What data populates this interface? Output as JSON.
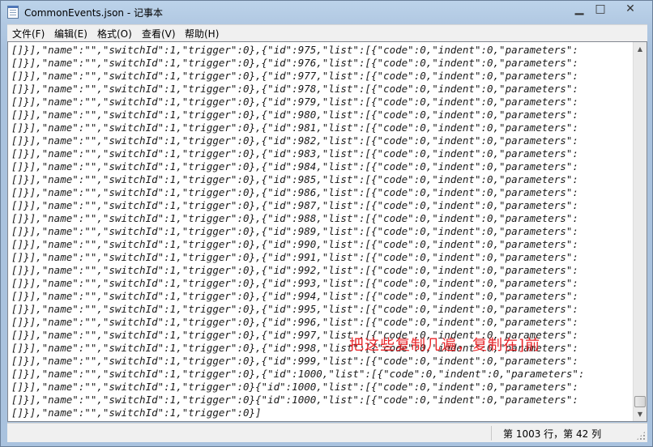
{
  "window": {
    "file_name": "CommonEvents.json",
    "separator": " - ",
    "app_name": "记事本"
  },
  "menu": [
    {
      "label": "文件(F)"
    },
    {
      "label": "编辑(E)"
    },
    {
      "label": "格式(O)"
    },
    {
      "label": "查看(V)"
    },
    {
      "label": "帮助(H)"
    }
  ],
  "editor": {
    "lines": [
      "[]}],\"name\":\"\",\"switchId\":1,\"trigger\":0},{\"id\":975,\"list\":[{\"code\":0,\"indent\":0,\"parameters\":",
      "[]}],\"name\":\"\",\"switchId\":1,\"trigger\":0},{\"id\":976,\"list\":[{\"code\":0,\"indent\":0,\"parameters\":",
      "[]}],\"name\":\"\",\"switchId\":1,\"trigger\":0},{\"id\":977,\"list\":[{\"code\":0,\"indent\":0,\"parameters\":",
      "[]}],\"name\":\"\",\"switchId\":1,\"trigger\":0},{\"id\":978,\"list\":[{\"code\":0,\"indent\":0,\"parameters\":",
      "[]}],\"name\":\"\",\"switchId\":1,\"trigger\":0},{\"id\":979,\"list\":[{\"code\":0,\"indent\":0,\"parameters\":",
      "[]}],\"name\":\"\",\"switchId\":1,\"trigger\":0},{\"id\":980,\"list\":[{\"code\":0,\"indent\":0,\"parameters\":",
      "[]}],\"name\":\"\",\"switchId\":1,\"trigger\":0},{\"id\":981,\"list\":[{\"code\":0,\"indent\":0,\"parameters\":",
      "[]}],\"name\":\"\",\"switchId\":1,\"trigger\":0},{\"id\":982,\"list\":[{\"code\":0,\"indent\":0,\"parameters\":",
      "[]}],\"name\":\"\",\"switchId\":1,\"trigger\":0},{\"id\":983,\"list\":[{\"code\":0,\"indent\":0,\"parameters\":",
      "[]}],\"name\":\"\",\"switchId\":1,\"trigger\":0},{\"id\":984,\"list\":[{\"code\":0,\"indent\":0,\"parameters\":",
      "[]}],\"name\":\"\",\"switchId\":1,\"trigger\":0},{\"id\":985,\"list\":[{\"code\":0,\"indent\":0,\"parameters\":",
      "[]}],\"name\":\"\",\"switchId\":1,\"trigger\":0},{\"id\":986,\"list\":[{\"code\":0,\"indent\":0,\"parameters\":",
      "[]}],\"name\":\"\",\"switchId\":1,\"trigger\":0},{\"id\":987,\"list\":[{\"code\":0,\"indent\":0,\"parameters\":",
      "[]}],\"name\":\"\",\"switchId\":1,\"trigger\":0},{\"id\":988,\"list\":[{\"code\":0,\"indent\":0,\"parameters\":",
      "[]}],\"name\":\"\",\"switchId\":1,\"trigger\":0},{\"id\":989,\"list\":[{\"code\":0,\"indent\":0,\"parameters\":",
      "[]}],\"name\":\"\",\"switchId\":1,\"trigger\":0},{\"id\":990,\"list\":[{\"code\":0,\"indent\":0,\"parameters\":",
      "[]}],\"name\":\"\",\"switchId\":1,\"trigger\":0},{\"id\":991,\"list\":[{\"code\":0,\"indent\":0,\"parameters\":",
      "[]}],\"name\":\"\",\"switchId\":1,\"trigger\":0},{\"id\":992,\"list\":[{\"code\":0,\"indent\":0,\"parameters\":",
      "[]}],\"name\":\"\",\"switchId\":1,\"trigger\":0},{\"id\":993,\"list\":[{\"code\":0,\"indent\":0,\"parameters\":",
      "[]}],\"name\":\"\",\"switchId\":1,\"trigger\":0},{\"id\":994,\"list\":[{\"code\":0,\"indent\":0,\"parameters\":",
      "[]}],\"name\":\"\",\"switchId\":1,\"trigger\":0},{\"id\":995,\"list\":[{\"code\":0,\"indent\":0,\"parameters\":",
      "[]}],\"name\":\"\",\"switchId\":1,\"trigger\":0},{\"id\":996,\"list\":[{\"code\":0,\"indent\":0,\"parameters\":",
      "[]}],\"name\":\"\",\"switchId\":1,\"trigger\":0},{\"id\":997,\"list\":[{\"code\":0,\"indent\":0,\"parameters\":",
      "[]}],\"name\":\"\",\"switchId\":1,\"trigger\":0},{\"id\":998,\"list\":[{\"code\":0,\"indent\":0,\"parameters\":",
      "[]}],\"name\":\"\",\"switchId\":1,\"trigger\":0},{\"id\":999,\"list\":[{\"code\":0,\"indent\":0,\"parameters\":",
      "[]}],\"name\":\"\",\"switchId\":1,\"trigger\":0},{\"id\":1000,\"list\":[{\"code\":0,\"indent\":0,\"parameters\":",
      "[]}],\"name\":\"\",\"switchId\":1,\"trigger\":0}{\"id\":1000,\"list\":[{\"code\":0,\"indent\":0,\"parameters\":",
      "[]}],\"name\":\"\",\"switchId\":1,\"trigger\":0}{\"id\":1000,\"list\":[{\"code\":0,\"indent\":0,\"parameters\":",
      "[]}],\"name\":\"\",\"switchId\":1,\"trigger\":0}]"
    ]
  },
  "annotation": {
    "text": "把这些复制几遍，复制在]前",
    "color": "#e8262a"
  },
  "status": {
    "position": "第 1003 行，第 42 列"
  }
}
